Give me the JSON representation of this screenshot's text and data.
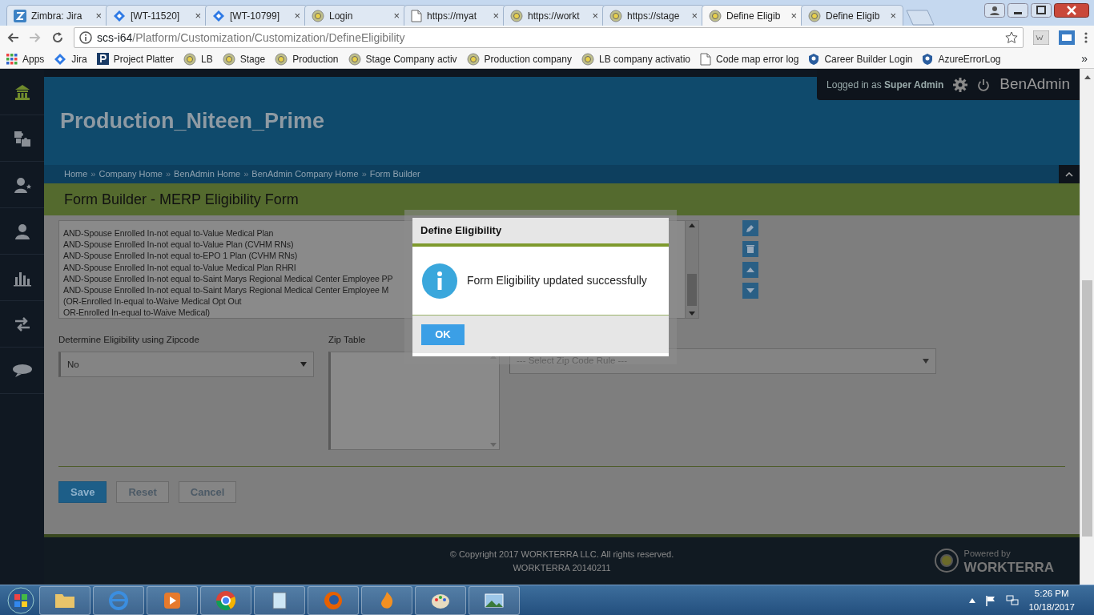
{
  "browser": {
    "tabs": [
      {
        "title": "Zimbra: Jira",
        "selected": false
      },
      {
        "title": "[WT-11520]",
        "selected": false
      },
      {
        "title": "[WT-10799]",
        "selected": false
      },
      {
        "title": "Login",
        "selected": false
      },
      {
        "title": "https://myat",
        "selected": false
      },
      {
        "title": "https://workt",
        "selected": false
      },
      {
        "title": "https://stage",
        "selected": false
      },
      {
        "title": "Define Eligib",
        "selected": true
      },
      {
        "title": "Define Eligib",
        "selected": false
      }
    ],
    "tab_close": "×",
    "address": {
      "host": "scs-i64",
      "path": "/Platform/Customization/Customization/DefineEligibility"
    },
    "bookmarks": [
      {
        "label": "Apps"
      },
      {
        "label": "Jira"
      },
      {
        "label": "Project Platter"
      },
      {
        "label": "LB"
      },
      {
        "label": "Stage"
      },
      {
        "label": "Production"
      },
      {
        "label": "Stage Company activ"
      },
      {
        "label": "Production company"
      },
      {
        "label": "LB company activatio"
      },
      {
        "label": "Code map error log"
      },
      {
        "label": "Career Builder Login"
      },
      {
        "label": "AzureErrorLog"
      }
    ],
    "more": "»"
  },
  "sidebar": {
    "items": [
      {
        "selected": true
      },
      {
        "selected": false
      },
      {
        "selected": false
      },
      {
        "selected": false
      },
      {
        "selected": false
      },
      {
        "selected": false
      },
      {
        "selected": false
      }
    ]
  },
  "header": {
    "company": "Production_Niteen_Prime",
    "user_prefix": "Logged in as",
    "user": "Super Admin",
    "brand": "BenAdmin",
    "separator": "»",
    "breadcrumbs": [
      "Home",
      "Company Home",
      "BenAdmin Home",
      "BenAdmin Company Home",
      "Form Builder"
    ]
  },
  "page_title": "Form Builder - MERP Eligibility Form",
  "rules": [
    "AND-Spouse Enrolled In-not equal to-Value Medical Plan",
    "AND-Spouse Enrolled In-not equal to-Value Plan (CVHM RNs)",
    "AND-Spouse Enrolled In-not equal to-EPO 1 Plan (CVHM RNs)",
    "AND-Spouse Enrolled In-not equal to-Value Medical Plan RHRI",
    "AND-Spouse Enrolled In-not equal to-Saint Marys Regional Medical Center Employee PP",
    "AND-Spouse Enrolled In-not equal to-Saint Marys Regional Medical Center Employee M",
    "(OR-Enrolled In-equal to-Waive Medical Opt Out",
    "OR-Enrolled In-equal to-Waive Medical)"
  ],
  "fields": {
    "zipcode_label": "Determine Eligibility using Zipcode",
    "zipcode_value": "No",
    "zip_table_label": "Zip Table",
    "zip_rule_value": "--- Select Zip Code Rule ---"
  },
  "buttons": [
    {
      "label": "Save",
      "kind": "primary"
    },
    {
      "label": "Reset",
      "kind": "secondary"
    },
    {
      "label": "Cancel",
      "kind": "secondary"
    }
  ],
  "footer": {
    "copyright": "© Copyright 2017 WORKTERRA LLC. All rights reserved.",
    "version": "WORKTERRA 20140211",
    "powered_by": "Powered by",
    "brand": "WORKTERRA"
  },
  "dialog": {
    "title": "Define Eligibility",
    "message": "Form Eligibility updated successfully",
    "ok": "OK"
  },
  "taskbar": {
    "time": "5:26 PM",
    "date": "10/18/2017"
  }
}
